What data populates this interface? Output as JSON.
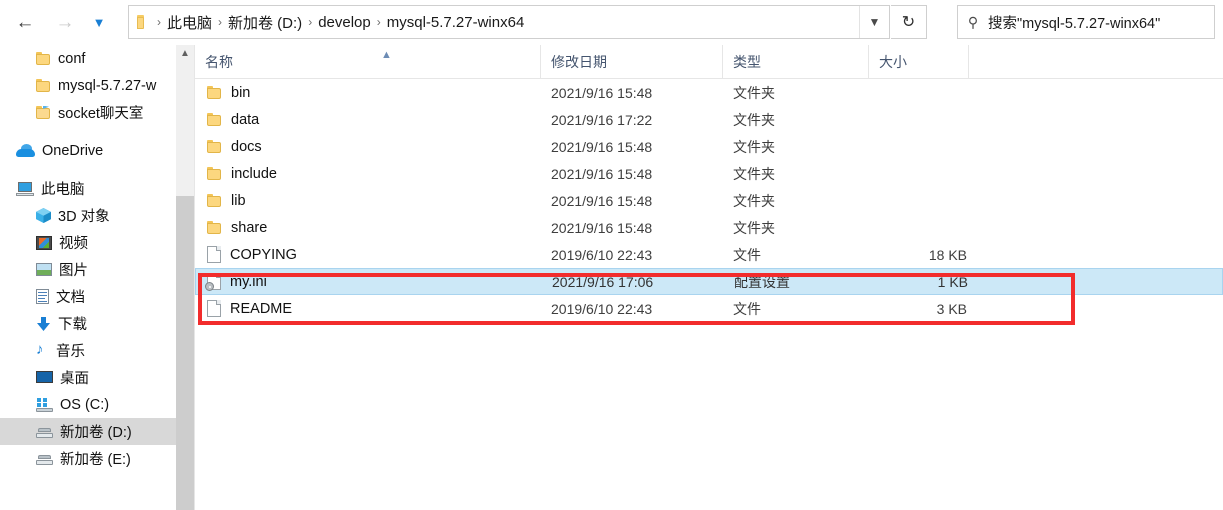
{
  "window": {
    "title": "mysql-5.7.27-winx64"
  },
  "toolbar": {
    "back_icon": "arrow-left-icon",
    "forward_icon": "arrow-right-icon",
    "recent_icon": "chevron-down-icon",
    "up_icon": "arrow-up-icon",
    "refresh_icon": "refresh-icon",
    "address_dropdown_icon": "chevron-down-icon",
    "folder_icon": "folder-icon",
    "separator": "›",
    "breadcrumbs": [
      "此电脑",
      "新加卷 (D:)",
      "develop",
      "mysql-5.7.27-winx64"
    ]
  },
  "search": {
    "icon": "search-icon",
    "value": "搜索\"mysql-5.7.27-winx64\"",
    "placeholder": "搜索\"mysql-5.7.27-winx64\""
  },
  "sidebar": {
    "scroll_up_icon": "chevron-up-icon",
    "items": [
      {
        "label": "conf",
        "icon": "folder-icon",
        "selected": false,
        "indent": 1
      },
      {
        "label": "mysql-5.7.27-w",
        "icon": "folder-icon",
        "selected": false,
        "indent": 1
      },
      {
        "label": "socket聊天室",
        "icon": "folder-open-icon",
        "selected": false,
        "indent": 1
      },
      {
        "label": "OneDrive",
        "icon": "cloud-icon",
        "selected": false,
        "indent": 0
      },
      {
        "label": "此电脑",
        "icon": "computer-icon",
        "selected": false,
        "indent": 0
      },
      {
        "label": "3D 对象",
        "icon": "cube-icon",
        "selected": false,
        "indent": 1
      },
      {
        "label": "视频",
        "icon": "video-icon",
        "selected": false,
        "indent": 1
      },
      {
        "label": "图片",
        "icon": "picture-icon",
        "selected": false,
        "indent": 1
      },
      {
        "label": "文档",
        "icon": "document-icon",
        "selected": false,
        "indent": 1
      },
      {
        "label": "下载",
        "icon": "download-icon",
        "selected": false,
        "indent": 1
      },
      {
        "label": "音乐",
        "icon": "music-icon",
        "selected": false,
        "indent": 1
      },
      {
        "label": "桌面",
        "icon": "desktop-icon",
        "selected": false,
        "indent": 1
      },
      {
        "label": "OS (C:)",
        "icon": "drive-windows-icon",
        "selected": false,
        "indent": 1
      },
      {
        "label": "新加卷 (D:)",
        "icon": "drive-icon",
        "selected": true,
        "indent": 1
      },
      {
        "label": "新加卷 (E:)",
        "icon": "drive-icon",
        "selected": false,
        "indent": 1
      }
    ]
  },
  "file_list": {
    "columns": [
      {
        "key": "name",
        "label": "名称",
        "sorted": true,
        "sort_icon": "chevron-up-icon"
      },
      {
        "key": "date",
        "label": "修改日期"
      },
      {
        "key": "type",
        "label": "类型"
      },
      {
        "key": "size",
        "label": "大小"
      }
    ],
    "rows": [
      {
        "name": "bin",
        "date": "2021/9/16 15:48",
        "type": "文件夹",
        "size": "",
        "icon": "folder-icon",
        "selected": false
      },
      {
        "name": "data",
        "date": "2021/9/16 17:22",
        "type": "文件夹",
        "size": "",
        "icon": "folder-icon",
        "selected": false
      },
      {
        "name": "docs",
        "date": "2021/9/16 15:48",
        "type": "文件夹",
        "size": "",
        "icon": "folder-icon",
        "selected": false
      },
      {
        "name": "include",
        "date": "2021/9/16 15:48",
        "type": "文件夹",
        "size": "",
        "icon": "folder-icon",
        "selected": false
      },
      {
        "name": "lib",
        "date": "2021/9/16 15:48",
        "type": "文件夹",
        "size": "",
        "icon": "folder-icon",
        "selected": false
      },
      {
        "name": "share",
        "date": "2021/9/16 15:48",
        "type": "文件夹",
        "size": "",
        "icon": "folder-icon",
        "selected": false
      },
      {
        "name": "COPYING",
        "date": "2019/6/10 22:43",
        "type": "文件",
        "size": "18 KB",
        "icon": "file-icon",
        "selected": false
      },
      {
        "name": "my.ini",
        "date": "2021/9/16 17:06",
        "type": "配置设置",
        "size": "1 KB",
        "icon": "ini-file-icon",
        "selected": true
      },
      {
        "name": "README",
        "date": "2019/6/10 22:43",
        "type": "文件",
        "size": "3 KB",
        "icon": "file-icon",
        "selected": false
      }
    ]
  },
  "annotation": {
    "color": "#f22c2c",
    "target": "my.ini"
  }
}
